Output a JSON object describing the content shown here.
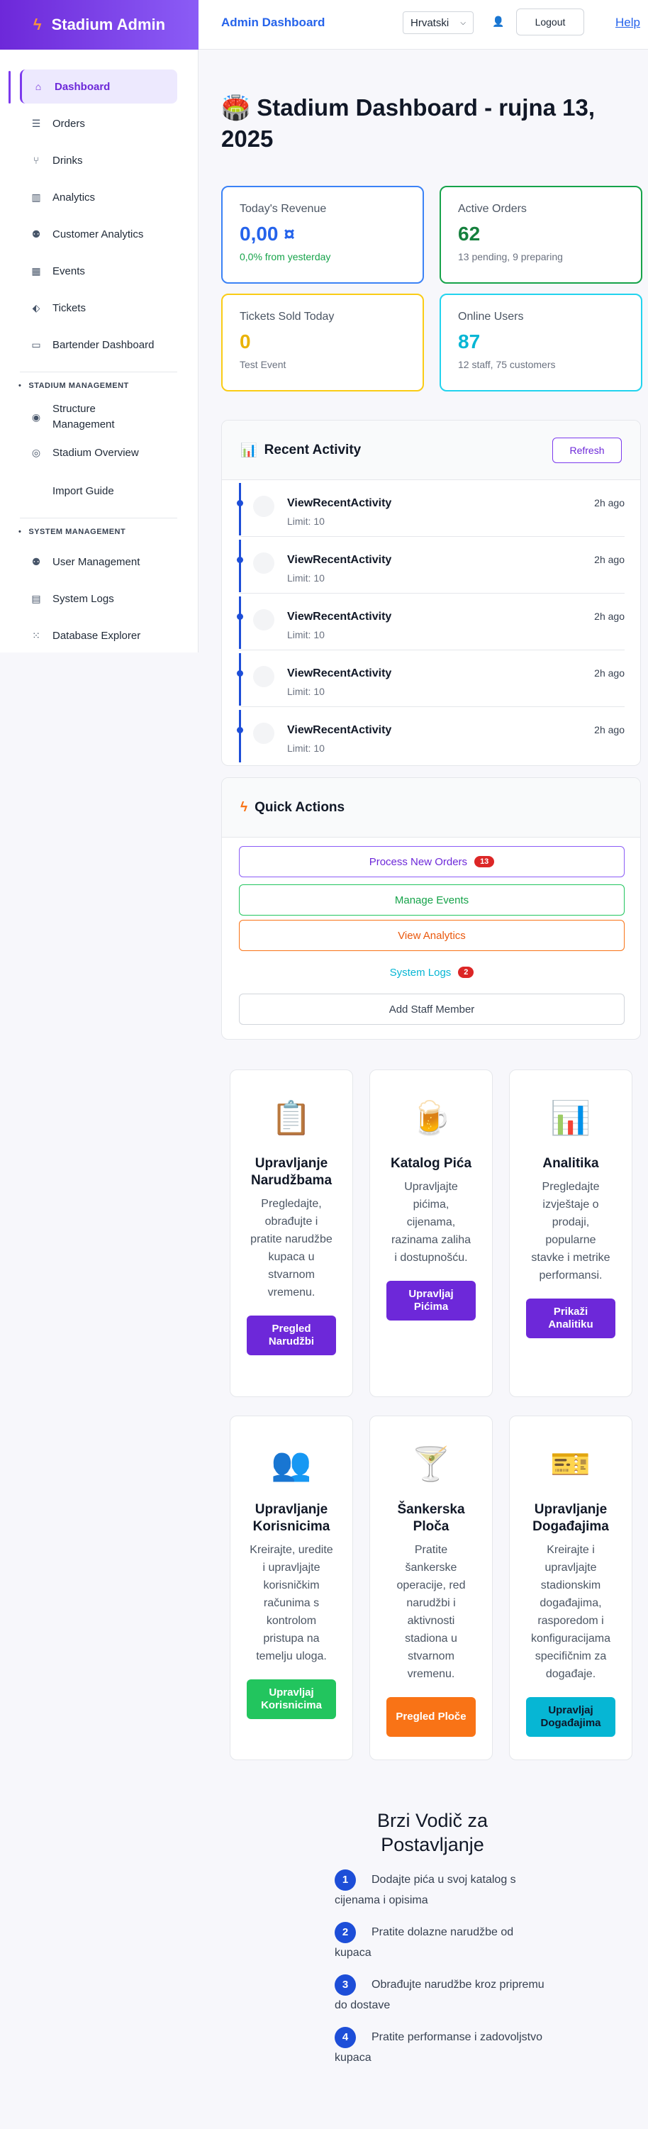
{
  "app": {
    "brand": "Stadium Admin",
    "top_title": "Admin Dashboard",
    "language": "Hrvatski",
    "logout": "Logout",
    "help": "Help"
  },
  "sidebar": {
    "items": [
      {
        "label": "Dashboard",
        "icon": "home-icon"
      },
      {
        "label": "Orders",
        "icon": "list-icon"
      },
      {
        "label": "Drinks",
        "icon": "drink-icon"
      },
      {
        "label": "Analytics",
        "icon": "chart-icon"
      },
      {
        "label": "Customer Analytics",
        "icon": "users-icon"
      },
      {
        "label": "Events",
        "icon": "calendar-icon"
      },
      {
        "label": "Tickets",
        "icon": "ticket-icon"
      },
      {
        "label": "Bartender Dashboard",
        "icon": "monitor-icon"
      }
    ],
    "section_stadium": "STADIUM MANAGEMENT",
    "stadium_items": [
      {
        "label": "Structure Management",
        "icon": "location-icon"
      },
      {
        "label": "Stadium Overview",
        "icon": "eye-icon"
      },
      {
        "label": "Import Guide",
        "icon": ""
      }
    ],
    "section_system": "SYSTEM MANAGEMENT",
    "system_items": [
      {
        "label": "User Management",
        "icon": "users-icon"
      },
      {
        "label": "System Logs",
        "icon": "file-icon"
      },
      {
        "label": "Database Explorer",
        "icon": "grid-icon"
      }
    ]
  },
  "page": {
    "title": "🏟️ Stadium Dashboard - rujna 13, 2025"
  },
  "stats": {
    "revenue": {
      "label": "Today's Revenue",
      "value": "0,00 ¤",
      "sub": "0,0% from yesterday",
      "color": "#2563eb"
    },
    "orders": {
      "label": "Active Orders",
      "value": "62",
      "sub": "13 pending, 9 preparing",
      "color": "#15803d"
    },
    "tickets": {
      "label": "Tickets Sold Today",
      "value": "0",
      "sub": "Test Event",
      "color": "#eab308"
    },
    "users": {
      "label": "Online Users",
      "value": "87",
      "sub": "12 staff, 75 customers",
      "color": "#06b6d4"
    }
  },
  "activity": {
    "title": "Recent Activity",
    "refresh": "Refresh",
    "items": [
      {
        "name": "ViewRecentActivity",
        "meta": "Limit: 10",
        "time": "2h ago"
      },
      {
        "name": "ViewRecentActivity",
        "meta": "Limit: 10",
        "time": "2h ago"
      },
      {
        "name": "ViewRecentActivity",
        "meta": "Limit: 10",
        "time": "2h ago"
      },
      {
        "name": "ViewRecentActivity",
        "meta": "Limit: 10",
        "time": "2h ago"
      },
      {
        "name": "ViewRecentActivity",
        "meta": "Limit: 10",
        "time": "2h ago"
      }
    ]
  },
  "quick": {
    "title": "Quick Actions",
    "process": "Process New Orders",
    "process_badge": "13",
    "events": "Manage Events",
    "analytics": "View Analytics",
    "logs": "System Logs",
    "logs_badge": "2",
    "staff": "Add Staff Member"
  },
  "features": [
    {
      "emoji": "📋",
      "title": "Upravljanje Narudžbama",
      "desc": "Pregledajte, obrađujte i pratite narudžbe kupaca u stvarnom vremenu.",
      "button": "Pregled Narudžbi",
      "color": "#6d28d9"
    },
    {
      "emoji": "🍺",
      "title": "Katalog Pića",
      "desc": "Upravljajte pićima, cijenama, razinama zaliha i dostupnošću.",
      "button": "Upravljaj Pićima",
      "color": "#6d28d9"
    },
    {
      "emoji": "📊",
      "title": "Analitika",
      "desc": "Pregledajte izvještaje o prodaji, popularne stavke i metrike performansi.",
      "button": "Prikaži Analitiku",
      "color": "#6d28d9"
    },
    {
      "emoji": "👥",
      "title": "Upravljanje Korisnicima",
      "desc": "Kreirajte, uredite i upravljajte korisničkim računima s kontrolom pristupa na temelju uloga.",
      "button": "Upravljaj Korisnicima",
      "color": "#22c55e"
    },
    {
      "emoji": "🍸",
      "title": "Šankerska Ploča",
      "desc": "Pratite šankerske operacije, red narudžbi i aktivnosti stadiona u stvarnom vremenu.",
      "button": "Pregled Ploče",
      "color": "#f97316"
    },
    {
      "emoji": "🎫",
      "title": "Upravljanje Događajima",
      "desc": "Kreirajte i upravljajte stadionskim događajima, rasporedom i konfiguracijama specifičnim za događaje.",
      "button": "Upravljaj Događajima",
      "color": "#06b6d4"
    }
  ],
  "guide": {
    "title": "Brzi Vodič za Postavljanje",
    "steps": [
      {
        "n": "1",
        "text": "Dodajte pića u svoj katalog s cijenama i opisima"
      },
      {
        "n": "2",
        "text": "Pratite dolazne narudžbe od kupaca"
      },
      {
        "n": "3",
        "text": "Obrađujte narudžbe kroz pripremu do dostave"
      },
      {
        "n": "4",
        "text": "Pratite performanse i zadovoljstvo kupaca"
      }
    ]
  }
}
